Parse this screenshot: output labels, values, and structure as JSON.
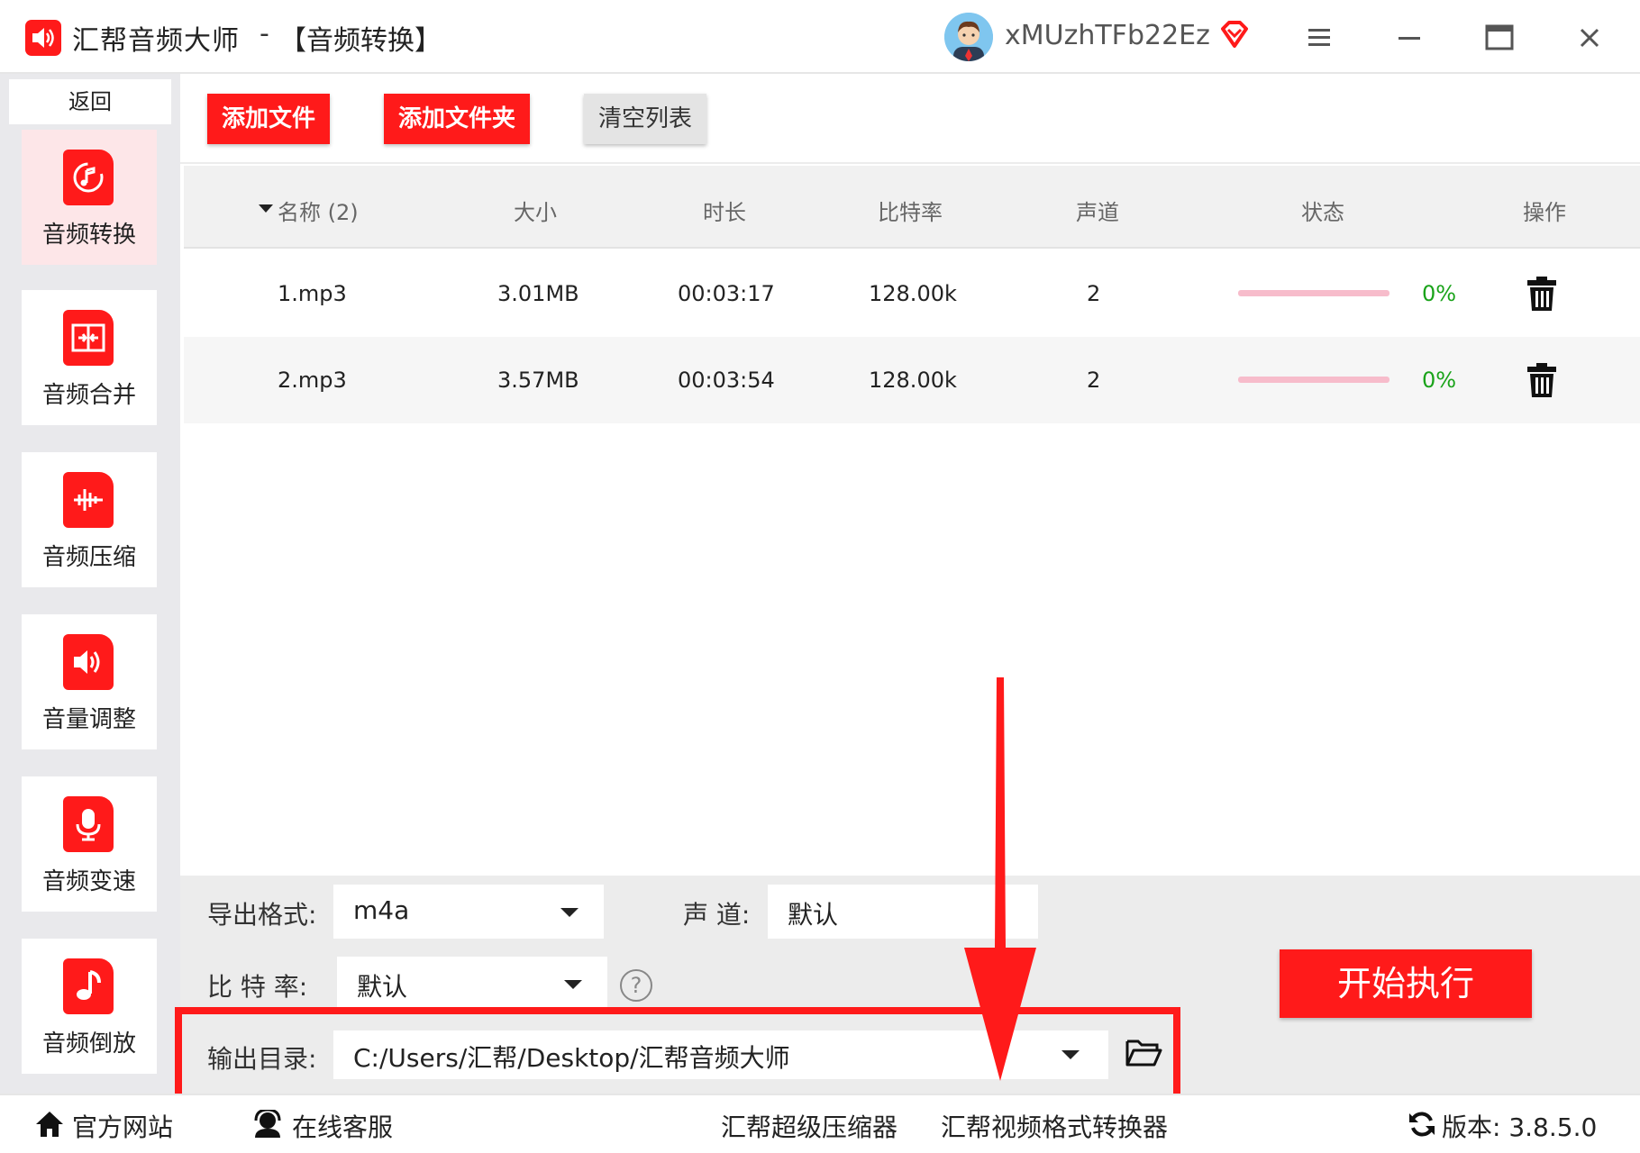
{
  "titlebar": {
    "app_name": "汇帮音频大师",
    "separator": "-",
    "module_title": "【音频转换】",
    "username": "xMUzhTFb22Ez"
  },
  "sidebar": {
    "back_label": "返回",
    "items": [
      {
        "label": "音频转换",
        "icon": "audio-convert-icon",
        "active": true
      },
      {
        "label": "音频合并",
        "icon": "audio-merge-icon",
        "active": false
      },
      {
        "label": "音频压缩",
        "icon": "audio-compress-icon",
        "active": false
      },
      {
        "label": "音量调整",
        "icon": "volume-icon",
        "active": false
      },
      {
        "label": "音频变速",
        "icon": "mic-icon",
        "active": false
      },
      {
        "label": "音频倒放",
        "icon": "music-note-icon",
        "active": false
      }
    ]
  },
  "toolbar": {
    "add_file": "添加文件",
    "add_folder": "添加文件夹",
    "clear_list": "清空列表"
  },
  "table": {
    "columns": [
      "名称 (2)",
      "大小",
      "时长",
      "比特率",
      "声道",
      "状态",
      "操作"
    ],
    "rows": [
      {
        "name": "1.mp3",
        "size": "3.01MB",
        "duration": "00:03:17",
        "bitrate": "128.00k",
        "channels": "2",
        "status": "0%",
        "progress": 0
      },
      {
        "name": "2.mp3",
        "size": "3.57MB",
        "duration": "00:03:54",
        "bitrate": "128.00k",
        "channels": "2",
        "status": "0%",
        "progress": 0
      }
    ]
  },
  "settings": {
    "format_label": "导出格式:",
    "format_value": "m4a",
    "channel_label": "声 道:",
    "channel_value": "默认",
    "bitrate_label": "比 特 率:",
    "bitrate_value": "默认",
    "help": "?",
    "output_label": "输出目录:",
    "output_value": "C:/Users/汇帮/Desktop/汇帮音频大师",
    "start_button": "开始执行"
  },
  "footer": {
    "website": "官方网站",
    "support": "在线客服",
    "compressor": "汇帮超级压缩器",
    "video_converter": "汇帮视频格式转换器",
    "version": "版本: 3.8.5.0"
  },
  "colors": {
    "accent": "#ff1a1a",
    "active_bg": "#fde6e8",
    "progress_track": "#f7bccb",
    "status_green": "#1aa31a"
  }
}
